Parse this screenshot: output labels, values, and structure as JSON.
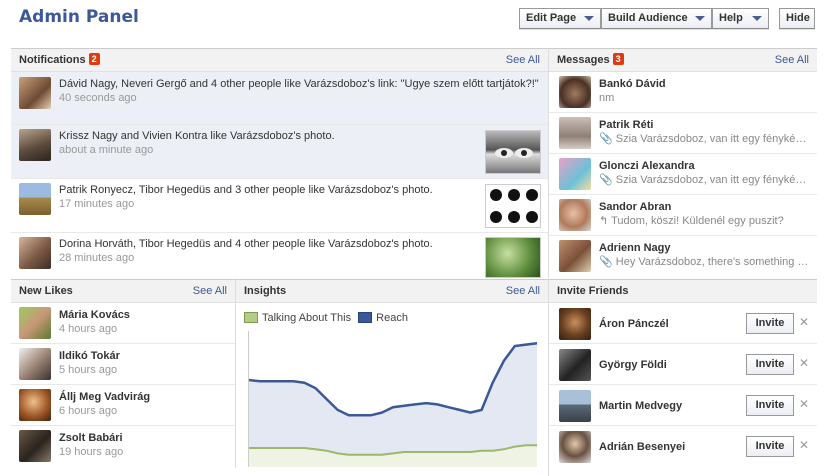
{
  "header": {
    "title": "Admin Panel",
    "edit_page": "Edit Page",
    "build_audience": "Build Audience",
    "help": "Help",
    "hide": "Hide"
  },
  "notifications": {
    "title": "Notifications",
    "count": "2",
    "see_all": "See All",
    "items": [
      {
        "text": "Dávid Nagy, Neveri Gergő and 4 other people like Varázsdoboz's link: \"Ugye szem előtt tartjátok?!\"",
        "time": "40 seconds ago"
      },
      {
        "text": "Krissz Nagy and Vivien Kontra like Varázsdoboz's photo.",
        "time": "about a minute ago"
      },
      {
        "text": "Patrik Ronyecz, Tibor Hegedüs and 3 other people like Varázsdoboz's photo.",
        "time": "17 minutes ago"
      },
      {
        "text": "Dorina Horváth, Tibor Hegedüs and 4 other people like Varázsdoboz's photo.",
        "time": "28 minutes ago"
      }
    ]
  },
  "messages": {
    "title": "Messages",
    "count": "3",
    "see_all": "See All",
    "items": [
      {
        "name": "Bankó Dávid",
        "snippet": "nm"
      },
      {
        "name": "Patrik Réti",
        "snippet": "Szia Varázsdoboz, van itt egy fényképem..."
      },
      {
        "name": "Glonczi Alexandra",
        "snippet": "Szia Varázsdoboz, van itt egy fényképem..."
      },
      {
        "name": "Sandor Abran",
        "snippet": "Tudom, köszi! Küldenél egy puszit?"
      },
      {
        "name": "Adrienn Nagy",
        "snippet": "Hey Varázsdoboz, there's something a..."
      }
    ]
  },
  "new_likes": {
    "title": "New Likes",
    "see_all": "See All",
    "items": [
      {
        "name": "Mária Kovács",
        "time": "4 hours ago"
      },
      {
        "name": "Ildikó Tokár",
        "time": "5 hours ago"
      },
      {
        "name": "Állj Meg Vadvirág",
        "time": "6 hours ago"
      },
      {
        "name": "Zsolt Babári",
        "time": "19 hours ago"
      }
    ]
  },
  "insights": {
    "title": "Insights",
    "see_all": "See All"
  },
  "invite": {
    "title": "Invite Friends",
    "button": "Invite",
    "items": [
      {
        "name": "Áron Pánczél"
      },
      {
        "name": "György Földi"
      },
      {
        "name": "Martin Medvegy"
      },
      {
        "name": "Adrián Besenyei"
      }
    ]
  },
  "icons": {
    "attachment": "paperclip-icon",
    "reply": "reply-arrow-icon",
    "close": "close-icon",
    "dropdown": "caret-down-icon"
  },
  "colors": {
    "link": "#3b5998",
    "badge": "#dd3c10",
    "reach_line": "#3b5998",
    "reach_fill": "#e3e8f2",
    "talking_line": "#9cb868",
    "talking_fill": "#eef3e4"
  },
  "chart_data": {
    "type": "area",
    "series": [
      {
        "name": "Talking About This",
        "color": "#9cb868",
        "values": [
          14,
          14,
          14,
          14,
          14,
          14,
          13,
          12,
          10,
          9,
          9,
          9,
          9,
          10,
          11,
          11,
          11,
          11,
          11,
          11,
          11,
          12,
          12,
          13,
          15,
          16,
          16
        ]
      },
      {
        "name": "Reach",
        "color": "#3b5998",
        "values": [
          64,
          63,
          63,
          63,
          63,
          62,
          58,
          50,
          42,
          38,
          38,
          38,
          40,
          44,
          45,
          46,
          47,
          46,
          44,
          42,
          40,
          42,
          62,
          78,
          89,
          90,
          91
        ]
      }
    ],
    "ylim": [
      0,
      100
    ],
    "grid": false,
    "legend": "top-left"
  }
}
